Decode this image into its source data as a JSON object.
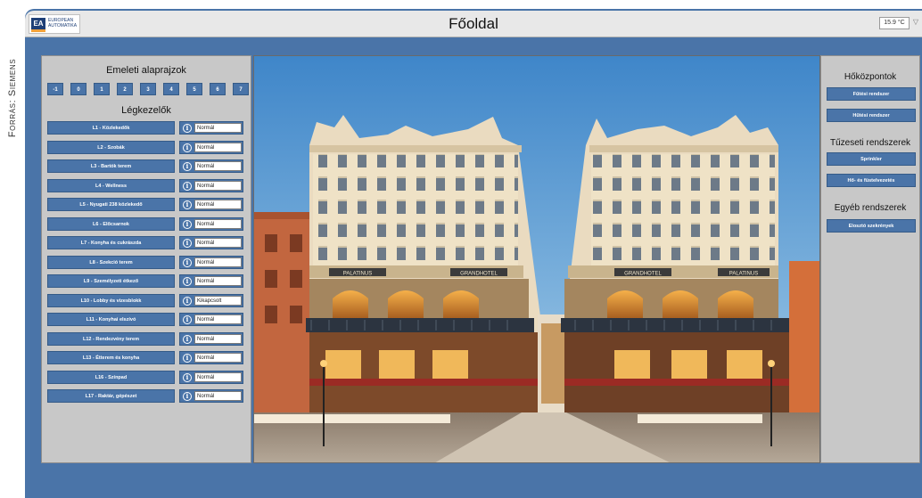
{
  "caption": "Forrás: Siemens",
  "header": {
    "logo_mark": "EA",
    "logo_text_1": "EUROPEAN",
    "logo_text_2": "AUTOMATIKA",
    "title": "Főoldal",
    "temperature": "15.9 °C"
  },
  "left_panel": {
    "floors_title": "Emeleti alaprajzok",
    "floors": [
      "-1",
      "0",
      "1",
      "2",
      "3",
      "4",
      "5",
      "6",
      "7"
    ],
    "ahu_title": "Légkezelők",
    "ahu_units": [
      {
        "label": "L1 - Közlekedők",
        "status": "Normál"
      },
      {
        "label": "L2 - Szobák",
        "status": "Normál"
      },
      {
        "label": "L3 - Bartók terem",
        "status": "Normál"
      },
      {
        "label": "L4 - Wellness",
        "status": "Normál"
      },
      {
        "label": "L5 - Nyugati 238 közlekedő",
        "status": "Normál"
      },
      {
        "label": "L6 - Előcsarnok",
        "status": "Normál"
      },
      {
        "label": "L7 - Konyha és cukrászda",
        "status": "Normál"
      },
      {
        "label": "L8 - Szekció terem",
        "status": "Normál"
      },
      {
        "label": "L9 - Személyzeti étkező",
        "status": "Normál"
      },
      {
        "label": "L10 - Lobby és vizesblokk",
        "status": "Kikapcsolt"
      },
      {
        "label": "L11 - Konyhai elszívó",
        "status": "Normál"
      },
      {
        "label": "L12 - Rendezvény terem",
        "status": "Normál"
      },
      {
        "label": "L13 - Étterem és konyha",
        "status": "Normál"
      },
      {
        "label": "L16 - Színpad",
        "status": "Normál"
      },
      {
        "label": "L17 - Raktár, gépészet",
        "status": "Normál"
      }
    ]
  },
  "photo": {
    "sign_left_1": "PALATINUS",
    "sign_left_2": "GRANDHOTEL",
    "sign_right_1": "GRANDHOTEL",
    "sign_right_2": "PALATINUS"
  },
  "right_panel": {
    "heat_title": "Hőközpontok",
    "heating_btn": "Fűtési rendszer",
    "cooling_btn": "Hűtési rendszer",
    "fire_title": "Tűzeseti rendszerek",
    "sprinkler_btn": "Sprinkler",
    "smoke_btn": "Hő- és füstelvezetés",
    "other_title": "Egyéb rendszerek",
    "distribution_btn": "Elosztó szekrények"
  },
  "colors": {
    "frame_blue": "#4a74a8",
    "panel_gray": "#c8c8c8",
    "sky": "#5a9bd4"
  }
}
